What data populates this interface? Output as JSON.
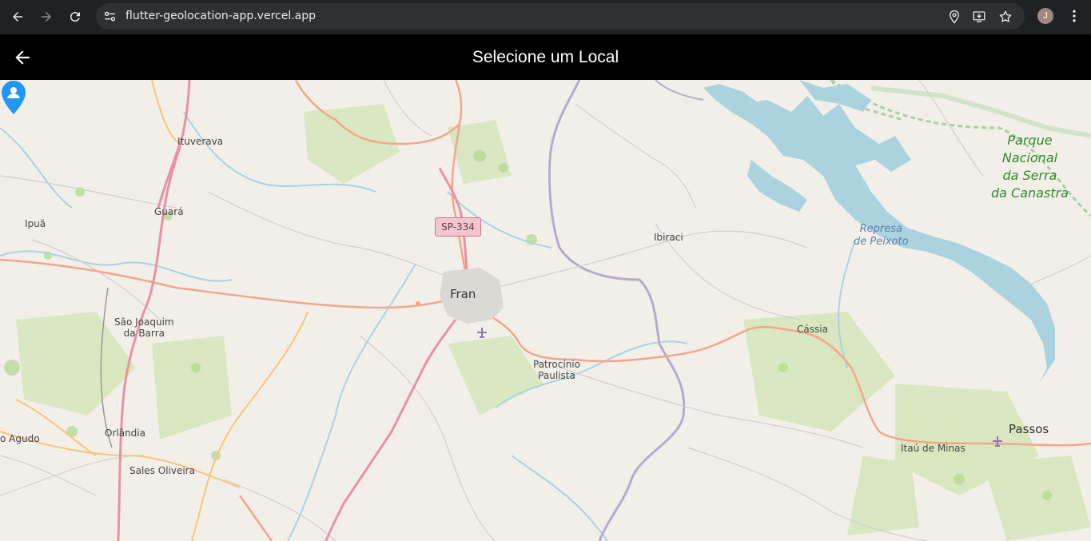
{
  "browser": {
    "url": "flutter-geolocation-app.vercel.app",
    "avatar_initial": "J",
    "icons": [
      "back-icon",
      "forward-icon",
      "reload-icon",
      "site-info-icon",
      "location-icon",
      "install-icon",
      "bookmark-star-icon",
      "menu-icon"
    ]
  },
  "appbar": {
    "title": "Selecione um Local",
    "background": "#000000"
  },
  "map": {
    "cities": {
      "ituverava": "Ituverava",
      "guara": "Guará",
      "ipua": "Ipuã",
      "sao_joaquim_1": "São Joaquim",
      "sao_joaquim_2": "da Barra",
      "franca": "Fran",
      "patrocinio_1": "Patrocínio",
      "patrocinio_2": "Paulista",
      "ibiraci": "Ibiraci",
      "cassia": "Cássia",
      "orlandia": "Orlândia",
      "sales_oliveira": "Sales Oliveira",
      "agudo": "o Agudo",
      "itau": "Itaú de Minas",
      "passos": "Passos"
    },
    "park": [
      "Parque",
      "Nacional",
      "da Serra",
      "da Canastra"
    ],
    "water": [
      "Represa",
      "de Peixoto"
    ],
    "road_shield": "SP-334",
    "marker_color": "#2196f3",
    "water_color": "#aad3df",
    "motorway_color": "#e892a2",
    "trunk_color": "#f9b29c"
  }
}
